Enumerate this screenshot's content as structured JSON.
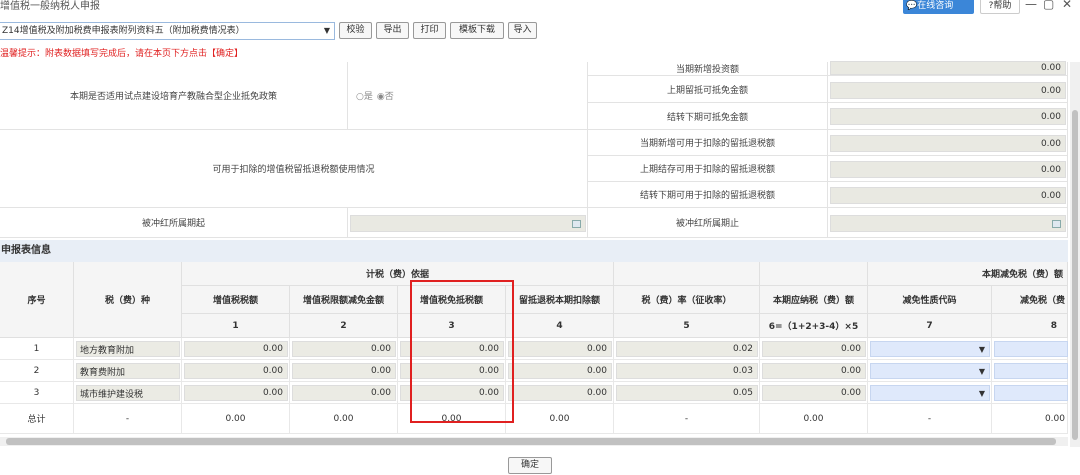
{
  "titlebar": {
    "title": "增值税一般纳税人申报",
    "consult_label": "在线咨询",
    "help_label": "?帮助",
    "minimize": "—",
    "restore": "▢",
    "close": "✕"
  },
  "toolbar": {
    "form_select": "Z14增值税及附加税费申报表附列资料五（附加税费情况表）",
    "buttons": [
      "校验",
      "导出",
      "打印",
      "模板下载",
      "导入"
    ]
  },
  "tip": "温馨提示：附表数据填写完成后，请在本页下方点击【确定】",
  "upper": {
    "pilot_policy_label": "本期是否适用试点建设培育产教融合型企业抵免政策",
    "pilot_yes": "是",
    "pilot_no": "否",
    "invest_label": "当期新增投资额",
    "invest_value": "0.00",
    "prev_credit_label": "上期留抵可抵免金额",
    "prev_credit_value": "0.00",
    "carry_credit_label": "结转下期可抵免金额",
    "carry_credit_value": "0.00",
    "refund_usage_label": "可用于扣除的增值税留抵退税额使用情况",
    "new_refund_label": "当期新增可用于扣除的留抵退税额",
    "new_refund_value": "0.00",
    "prev_refund_label": "上期结存可用于扣除的留抵退税额",
    "prev_refund_value": "0.00",
    "carry_refund_label": "结转下期可用于扣除的留抵退税额",
    "carry_refund_value": "0.00",
    "period_start_label": "被冲红所属期起",
    "period_end_label": "被冲红所属期止"
  },
  "section_title": "申报表信息",
  "table": {
    "col_seq": "序号",
    "col_tax": "税（费）种",
    "group_basis": "计税（费）依据",
    "group_relief": "本期减免税（费）额",
    "col_vat": "增值税税额",
    "col_vat_reduce": "增值税限额减免金额",
    "col_vat_exempt": "增值税免抵税额",
    "col_refund_deduct": "留抵退税本期扣除额",
    "col_rate": "税（费）率（征收率）",
    "col_payable": "本期应纳税（费）额",
    "col_relief_code": "减免性质代码",
    "col_relief_amount": "减免税（费",
    "nums": [
      "1",
      "2",
      "3",
      "4",
      "5",
      "6=（1+2+3-4）×5",
      "7",
      "8"
    ],
    "rows": [
      {
        "seq": "1",
        "name": "地方教育附加",
        "vat": "0.00",
        "reduce": "0.00",
        "exempt": "0.00",
        "deduct": "0.00",
        "rate": "0.02",
        "payable": "0.00"
      },
      {
        "seq": "2",
        "name": "教育费附加",
        "vat": "0.00",
        "reduce": "0.00",
        "exempt": "0.00",
        "deduct": "0.00",
        "rate": "0.03",
        "payable": "0.00"
      },
      {
        "seq": "3",
        "name": "城市维护建设税",
        "vat": "0.00",
        "reduce": "0.00",
        "exempt": "0.00",
        "deduct": "0.00",
        "rate": "0.05",
        "payable": "0.00"
      }
    ],
    "total": {
      "label": "总计",
      "tax": "-",
      "vat": "0.00",
      "reduce": "0.00",
      "exempt": "0.00",
      "deduct": "0.00",
      "rate": "-",
      "payable": "0.00",
      "code": "-",
      "amount": "0.00"
    }
  },
  "confirm_label": "确定"
}
